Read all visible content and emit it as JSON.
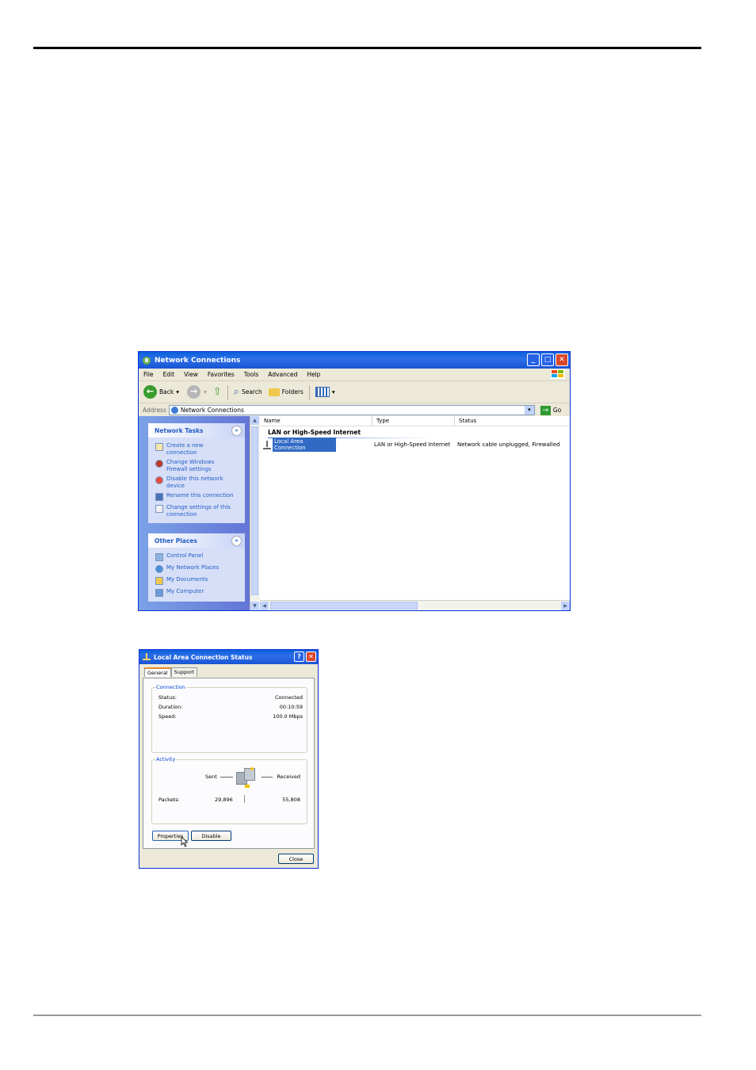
{
  "network_connections": {
    "title": "Network Connections",
    "menu": [
      "File",
      "Edit",
      "View",
      "Favorites",
      "Tools",
      "Advanced",
      "Help"
    ],
    "toolbar": {
      "back": "Back",
      "search": "Search",
      "folders": "Folders"
    },
    "address": {
      "label": "Address",
      "value": "Network Connections",
      "go": "Go"
    },
    "network_tasks": {
      "title": "Network Tasks",
      "items": [
        "Create a new connection",
        "Change Windows Firewall settings",
        "Disable this network device",
        "Rename this connection",
        "Change settings of this connection"
      ]
    },
    "other_places": {
      "title": "Other Places",
      "items": [
        "Control Panel",
        "My Network Places",
        "My Documents",
        "My Computer"
      ]
    },
    "columns": {
      "name": "Name",
      "type": "Type",
      "status": "Status"
    },
    "group": "LAN or High-Speed Internet",
    "row": {
      "name": "Local Area Connection",
      "type": "LAN or High-Speed Internet",
      "status": "Network cable unplugged, Firewalled"
    }
  },
  "status_dialog": {
    "title": "Local Area Connection Status",
    "tabs": [
      "General",
      "Support"
    ],
    "connection": {
      "label": "Connection",
      "status_label": "Status:",
      "status_value": "Connected",
      "duration_label": "Duration:",
      "duration_value": "00:10:59",
      "speed_label": "Speed:",
      "speed_value": "100.0 Mbps"
    },
    "activity": {
      "label": "Activity",
      "sent": "Sent",
      "received": "Received",
      "packets_label": "Packets:",
      "packets_sent": "29,896",
      "packets_received": "55,808"
    },
    "buttons": {
      "properties": "Properties",
      "disable": "Disable",
      "close": "Close"
    }
  }
}
